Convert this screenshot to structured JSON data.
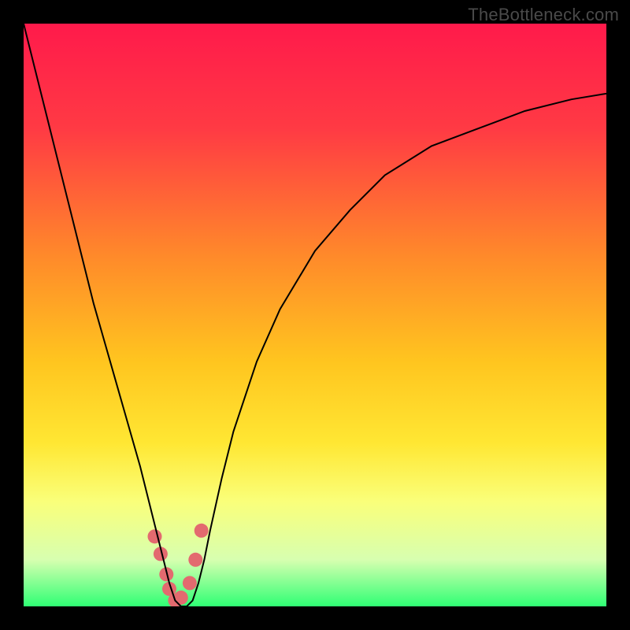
{
  "watermark": "TheBottleneck.com",
  "chart_data": {
    "type": "line",
    "title": "",
    "xlabel": "",
    "ylabel": "",
    "xlim": [
      0,
      100
    ],
    "ylim": [
      0,
      100
    ],
    "gradient_stops": [
      {
        "offset": 0.0,
        "color": "#ff1a4b"
      },
      {
        "offset": 0.18,
        "color": "#ff3a44"
      },
      {
        "offset": 0.4,
        "color": "#ff8a2a"
      },
      {
        "offset": 0.58,
        "color": "#ffc51f"
      },
      {
        "offset": 0.72,
        "color": "#ffe733"
      },
      {
        "offset": 0.82,
        "color": "#faff7a"
      },
      {
        "offset": 0.92,
        "color": "#d7ffb0"
      },
      {
        "offset": 1.0,
        "color": "#2fff74"
      }
    ],
    "series": [
      {
        "name": "curve",
        "type": "line",
        "color": "#000000",
        "x": [
          0,
          2,
          4,
          6,
          8,
          10,
          12,
          14,
          16,
          18,
          20,
          21,
          22,
          23,
          24,
          25,
          26,
          27,
          28,
          29,
          30,
          31,
          32,
          34,
          36,
          40,
          44,
          50,
          56,
          62,
          70,
          78,
          86,
          94,
          100
        ],
        "y": [
          100,
          92,
          84,
          76,
          68,
          60,
          52,
          45,
          38,
          31,
          24,
          20,
          16,
          12,
          8,
          4,
          1,
          0,
          0,
          1,
          4,
          8,
          13,
          22,
          30,
          42,
          51,
          61,
          68,
          74,
          79,
          82,
          85,
          87,
          88
        ]
      },
      {
        "name": "bead-markers",
        "type": "scatter",
        "color": "#e36a6f",
        "x": [
          22.5,
          23.5,
          24.5,
          25.0,
          26.0,
          27.0,
          28.5,
          29.5,
          30.5
        ],
        "y": [
          12,
          9,
          5.5,
          3,
          1,
          1.5,
          4,
          8,
          13
        ]
      }
    ],
    "baseline_y": 0
  }
}
